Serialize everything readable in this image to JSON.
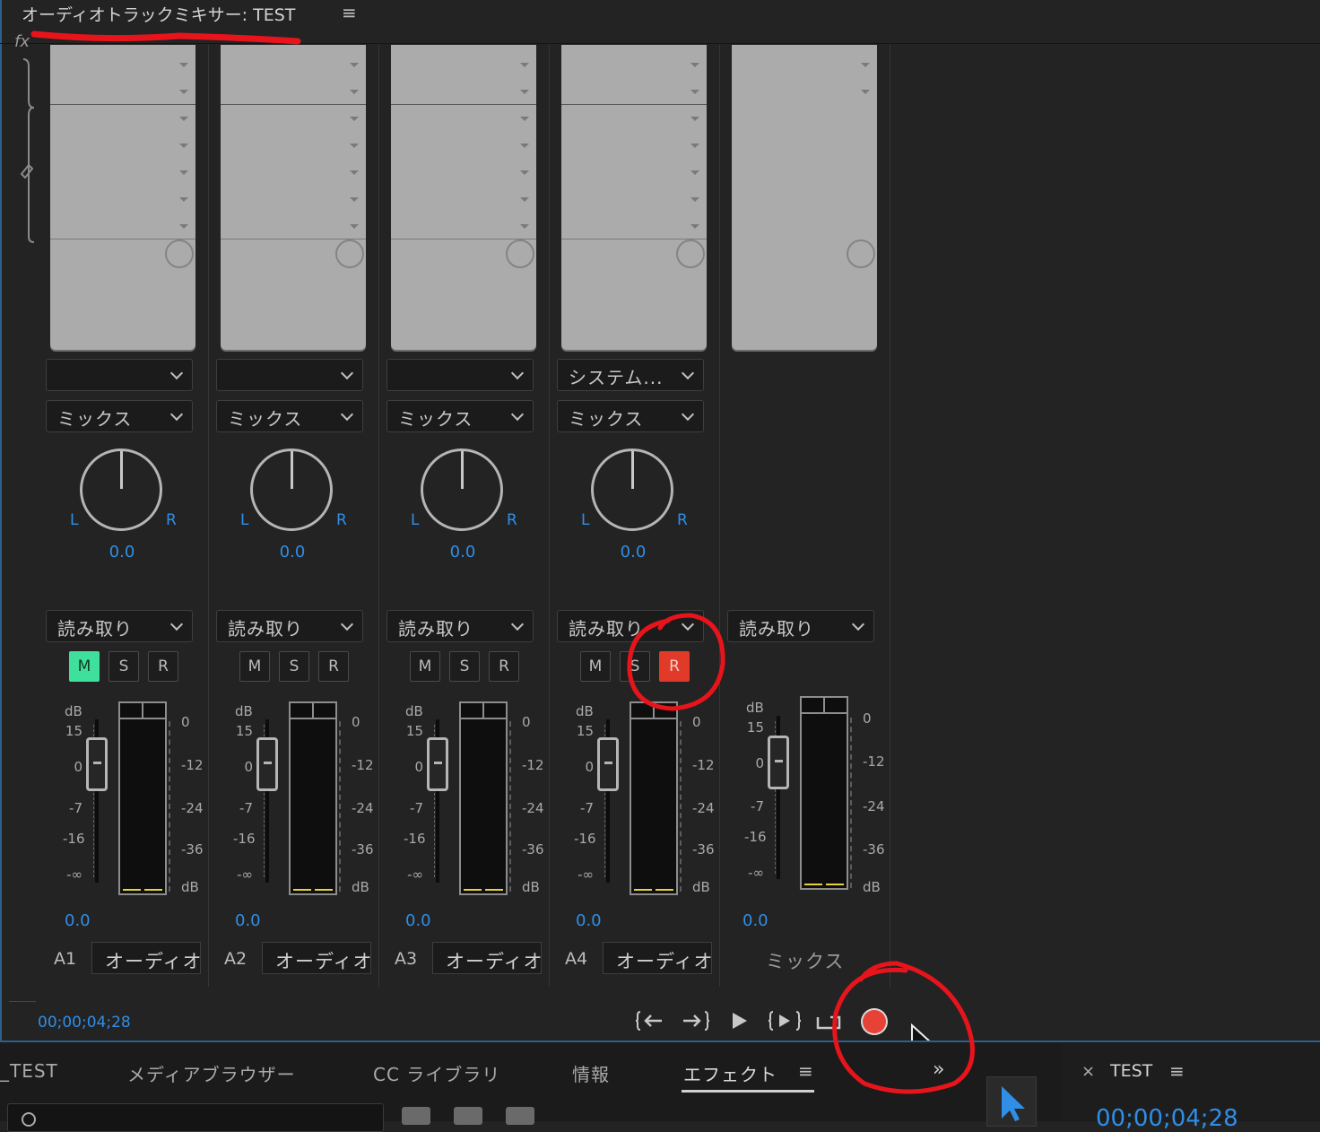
{
  "panel": {
    "title": "オーディオトラックミキサー: TEST",
    "menu_icon": "≡",
    "fx_label": "fx"
  },
  "strips": [
    {
      "input": "",
      "mix": "ミックス",
      "pan_l": "L",
      "pan_r": "R",
      "pan_value": "0.0",
      "automation": "読み取り",
      "mute": "M",
      "solo": "S",
      "record": "R",
      "mute_on": true,
      "record_on": false,
      "volume_value": "0.0",
      "track_id": "A1",
      "track_name": "オーディオ"
    },
    {
      "input": "",
      "mix": "ミックス",
      "pan_l": "L",
      "pan_r": "R",
      "pan_value": "0.0",
      "automation": "読み取り",
      "mute": "M",
      "solo": "S",
      "record": "R",
      "mute_on": false,
      "record_on": false,
      "volume_value": "0.0",
      "track_id": "A2",
      "track_name": "オーディオ"
    },
    {
      "input": "",
      "mix": "ミックス",
      "pan_l": "L",
      "pan_r": "R",
      "pan_value": "0.0",
      "automation": "読み取り",
      "mute": "M",
      "solo": "S",
      "record": "R",
      "mute_on": false,
      "record_on": false,
      "volume_value": "0.0",
      "track_id": "A3",
      "track_name": "オーディオ"
    },
    {
      "input": "システム...",
      "mix": "ミックス",
      "pan_l": "L",
      "pan_r": "R",
      "pan_value": "0.0",
      "automation": "読み取り",
      "mute": "M",
      "solo": "S",
      "record": "R",
      "mute_on": false,
      "record_on": true,
      "volume_value": "0.0",
      "track_id": "A4",
      "track_name": "オーディオ"
    }
  ],
  "master": {
    "automation": "読み取り",
    "volume_value": "0.0",
    "name": "ミックス"
  },
  "fader_scale": {
    "header": "dB",
    "marks": [
      "15",
      "0",
      "-7",
      "-16",
      "-∞"
    ]
  },
  "meter_scale": {
    "marks": [
      "0",
      "-12",
      "-24",
      "-36",
      "dB"
    ]
  },
  "transport": {
    "timecode": "00;00;04;28",
    "record_color": "#e84135"
  },
  "bottom_tabs": [
    "_TEST",
    "メディアブラウザー",
    "CC ライブラリ",
    "情報",
    "エフェクト"
  ],
  "bottom_active_tab": "エフェクト",
  "bottom_menu_icon": "≡",
  "overflow_icon": "»",
  "sequence_panel": {
    "close": "×",
    "tab": "TEST",
    "menu_icon": "≡",
    "timecode": "00;00;04;28"
  },
  "colors": {
    "accent_blue": "#2f8ee6",
    "mute_green": "#3fe09c",
    "record_red": "#e23a28",
    "annotation_red": "#e8141c"
  }
}
